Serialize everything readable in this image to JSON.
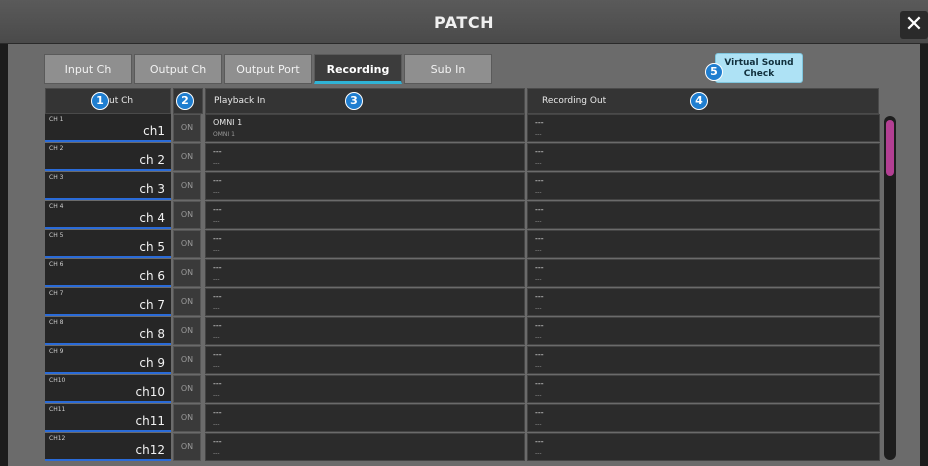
{
  "window": {
    "title": "PATCH",
    "close_glyph": "✕"
  },
  "tabs": [
    {
      "label": "Input Ch",
      "active": false
    },
    {
      "label": "Output Ch",
      "active": false
    },
    {
      "label": "Output Port",
      "active": false
    },
    {
      "label": "Recording",
      "active": true
    },
    {
      "label": "Sub In",
      "active": false
    }
  ],
  "virtual_sound_check": {
    "line1": "Virtual Sound",
    "line2": "Check"
  },
  "columns": {
    "input_ch": "Input Ch",
    "playback_in": "Playback In",
    "recording_out": "Recording Out"
  },
  "callouts": [
    "1",
    "2",
    "3",
    "4",
    "5"
  ],
  "rows": [
    {
      "ch": "CH 1",
      "name": "ch1",
      "on": "ON",
      "pb_main": "OMNI 1",
      "pb_sub": "OMNI 1",
      "ro_main": "---",
      "ro_sub": "---"
    },
    {
      "ch": "CH 2",
      "name": "ch 2",
      "on": "ON",
      "pb_main": "---",
      "pb_sub": "---",
      "ro_main": "---",
      "ro_sub": "---"
    },
    {
      "ch": "CH 3",
      "name": "ch 3",
      "on": "ON",
      "pb_main": "---",
      "pb_sub": "---",
      "ro_main": "---",
      "ro_sub": "---"
    },
    {
      "ch": "CH 4",
      "name": "ch 4",
      "on": "ON",
      "pb_main": "---",
      "pb_sub": "---",
      "ro_main": "---",
      "ro_sub": "---"
    },
    {
      "ch": "CH 5",
      "name": "ch 5",
      "on": "ON",
      "pb_main": "---",
      "pb_sub": "---",
      "ro_main": "---",
      "ro_sub": "---"
    },
    {
      "ch": "CH 6",
      "name": "ch 6",
      "on": "ON",
      "pb_main": "---",
      "pb_sub": "---",
      "ro_main": "---",
      "ro_sub": "---"
    },
    {
      "ch": "CH 7",
      "name": "ch 7",
      "on": "ON",
      "pb_main": "---",
      "pb_sub": "---",
      "ro_main": "---",
      "ro_sub": "---"
    },
    {
      "ch": "CH 8",
      "name": "ch 8",
      "on": "ON",
      "pb_main": "---",
      "pb_sub": "---",
      "ro_main": "---",
      "ro_sub": "---"
    },
    {
      "ch": "CH 9",
      "name": "ch 9",
      "on": "ON",
      "pb_main": "---",
      "pb_sub": "---",
      "ro_main": "---",
      "ro_sub": "---"
    },
    {
      "ch": "CH10",
      "name": "ch10",
      "on": "ON",
      "pb_main": "---",
      "pb_sub": "---",
      "ro_main": "---",
      "ro_sub": "---"
    },
    {
      "ch": "CH11",
      "name": "ch11",
      "on": "ON",
      "pb_main": "---",
      "pb_sub": "---",
      "ro_main": "---",
      "ro_sub": "---"
    },
    {
      "ch": "CH12",
      "name": "ch12",
      "on": "ON",
      "pb_main": "---",
      "pb_sub": "---",
      "ro_main": "---",
      "ro_sub": "---"
    }
  ],
  "colors": {
    "accent_tab": "#2fb3d6",
    "name_underline": "#2a6bd8",
    "scroll_thumb": "#b33f93",
    "vsc_button": "#aee2f5"
  }
}
